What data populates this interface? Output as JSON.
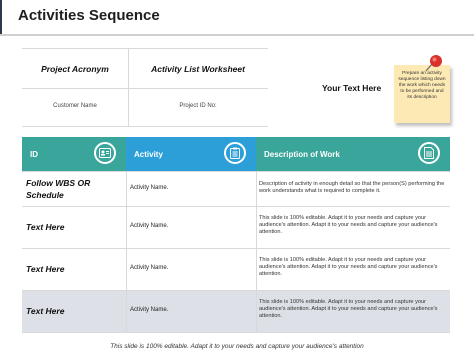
{
  "page": {
    "title": "Activities Sequence"
  },
  "top_table": {
    "col1_title": "Project Acronym",
    "col2_title": "Activity List Worksheet",
    "col1_sub": "Customer Name",
    "col2_sub": "Project ID No:"
  },
  "your_text": "Your Text Here",
  "note": {
    "text": "Prepare an activity sequence listing down the work which needs to be performed and its description"
  },
  "headers": [
    {
      "label": "ID",
      "icon": "id-card-icon",
      "color": "#3aa59b"
    },
    {
      "label": "Activity",
      "icon": "clipboard-icon",
      "color": "#2c9fd8"
    },
    {
      "label": "Description of Work",
      "icon": "document-icon",
      "color": "#3aa59b"
    }
  ],
  "rows": [
    {
      "title": "Follow WBS OR Schedule",
      "activity": "Activity Name.",
      "description": "Description of activity  in enough detail so that the person(S) performing the work understands what is required to complete it."
    },
    {
      "title": "Text Here",
      "activity": "Activity Name.",
      "description": "This slide is 100% editable. Adapt it to your needs and capture your audience's attention. Adapt it to your needs and capture your audience's attention."
    },
    {
      "title": "Text Here",
      "activity": "Activity Name.",
      "description": "This slide is 100% editable. Adapt it to your needs and capture your audience's attention. Adapt it to your needs and capture your audience's attention."
    },
    {
      "title": "Text Here",
      "activity": "Activity Name.",
      "description": "This slide is 100% editable. Adapt it to your needs and capture your audience's attention. Adapt it to your needs and capture your audience's attention."
    }
  ],
  "footer": "This slide is 100% editable. Adapt it to your needs and capture your audience's attention"
}
